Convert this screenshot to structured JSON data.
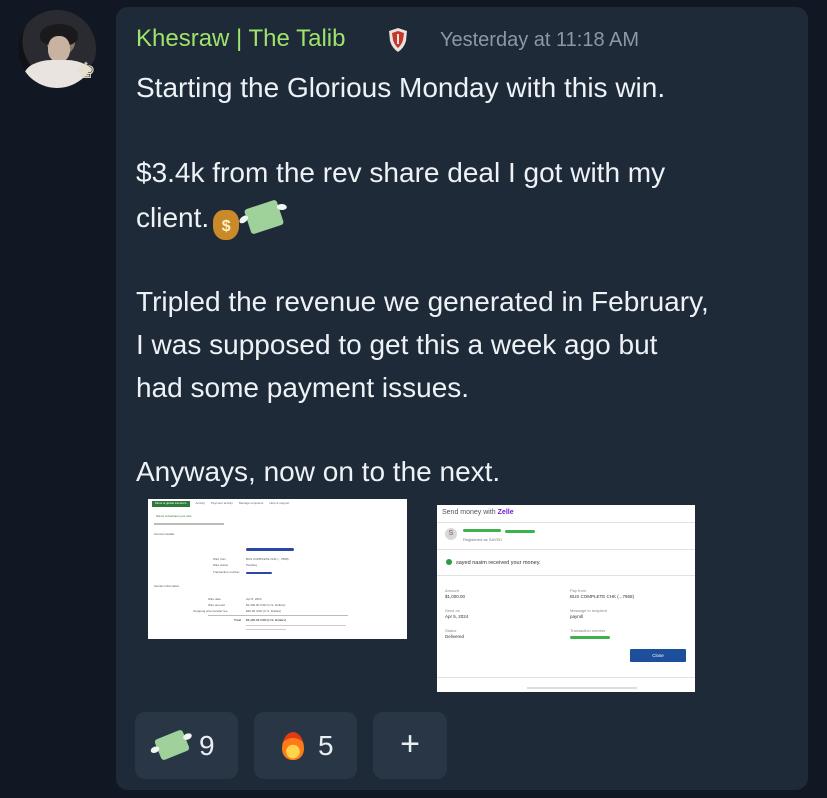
{
  "message": {
    "author": "Khesraw | The Talib",
    "timestamp": "Yesterday at 11:18 AM",
    "lines": [
      "Starting the Glorious Monday with this win.",
      "$3.4k from the rev share deal I got with my",
      "client.",
      "Tripled the revenue we generated in February,",
      "I was supposed to get this a week ago but",
      "had some payment issues.",
      "Anyways, now on to the next."
    ],
    "emoji": {
      "moneybag_glyph": "$"
    }
  },
  "attachments": {
    "bank_screenshot": {
      "tabs": [
        "Move & global transfers",
        "Activity",
        "Payment activity",
        "Manage recipients",
        "Help & support"
      ],
      "title": "We've scheduled your wire.",
      "account_label": "Account details",
      "sender_label": "Sender information",
      "summary_rows": [
        {
          "label": "Wire date",
          "value": "Apr 8, 2024"
        },
        {
          "label": "Wire amount",
          "value": "$2,400.00 USD (U.S. Dollars)"
        },
        {
          "label": "Outgoing wire transfer fee",
          "value": "$25.00 USD (U.S. Dollars)"
        },
        {
          "label": "Total",
          "value": "$2,425.00 USD (U.S. Dollars)"
        }
      ],
      "details_rows": [
        {
          "label": "Wire from",
          "value": "BUS COMPLETE CHK (...7868)"
        },
        {
          "label": "Wire status",
          "value": "Pending"
        },
        {
          "label": "Transaction number",
          "value": ""
        }
      ]
    },
    "zelle_screenshot": {
      "send_label": "Send money with",
      "brand": "Zelle",
      "avatar_initial": "S",
      "registered_text": "Registered as SAYED",
      "received_text": "sayed nasim received your money.",
      "fields": [
        {
          "label": "Amount",
          "value": "$1,000.00"
        },
        {
          "label": "Pay from",
          "value": "BUS COMPLETE CHK (...7868)"
        },
        {
          "label": "Send on",
          "value": "Apr 5, 2024"
        },
        {
          "label": "Message to recipient",
          "value": "payroll"
        },
        {
          "label": "Status",
          "value": "Delivered"
        },
        {
          "label": "Transaction number",
          "value": ""
        }
      ],
      "close_label": "Close"
    }
  },
  "reactions": [
    {
      "icon": "flying-money",
      "count": "9"
    },
    {
      "icon": "fire",
      "count": "5"
    },
    {
      "icon": "add-reaction",
      "label": "+"
    }
  ]
}
